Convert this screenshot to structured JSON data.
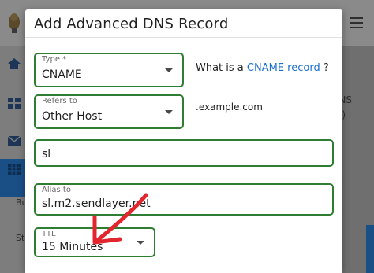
{
  "dialog": {
    "title": "Add Advanced DNS Record"
  },
  "fields": {
    "type": {
      "label": "Type *",
      "value": "CNAME"
    },
    "refers_to": {
      "label": "Refers to",
      "value": "Other Host"
    },
    "host": {
      "value": "sl"
    },
    "alias_to": {
      "label": "Alias to",
      "value": "sl.m2.sendlayer.net"
    },
    "ttl": {
      "label": "TTL",
      "value": "15 Minutes"
    }
  },
  "help": {
    "prefix": "What is a ",
    "link": "CNAME record",
    "suffix": " ?"
  },
  "domain_suffix": ".example.com",
  "background": {
    "side_labels": [
      "Bu",
      "Sta"
    ],
    "right_labels": [
      "NS",
      ")"
    ]
  },
  "colors": {
    "field_border": "#2e7d32",
    "link": "#1b6fd1",
    "annotation_arrow": "#e3262e",
    "sidebar_active": "#1a4f86"
  },
  "icons": [
    "logo-icon",
    "menu-icon",
    "home-icon",
    "dashboard-icon",
    "mail-icon",
    "grid-icon",
    "dropdown-caret-icon",
    "annotation-arrow"
  ]
}
